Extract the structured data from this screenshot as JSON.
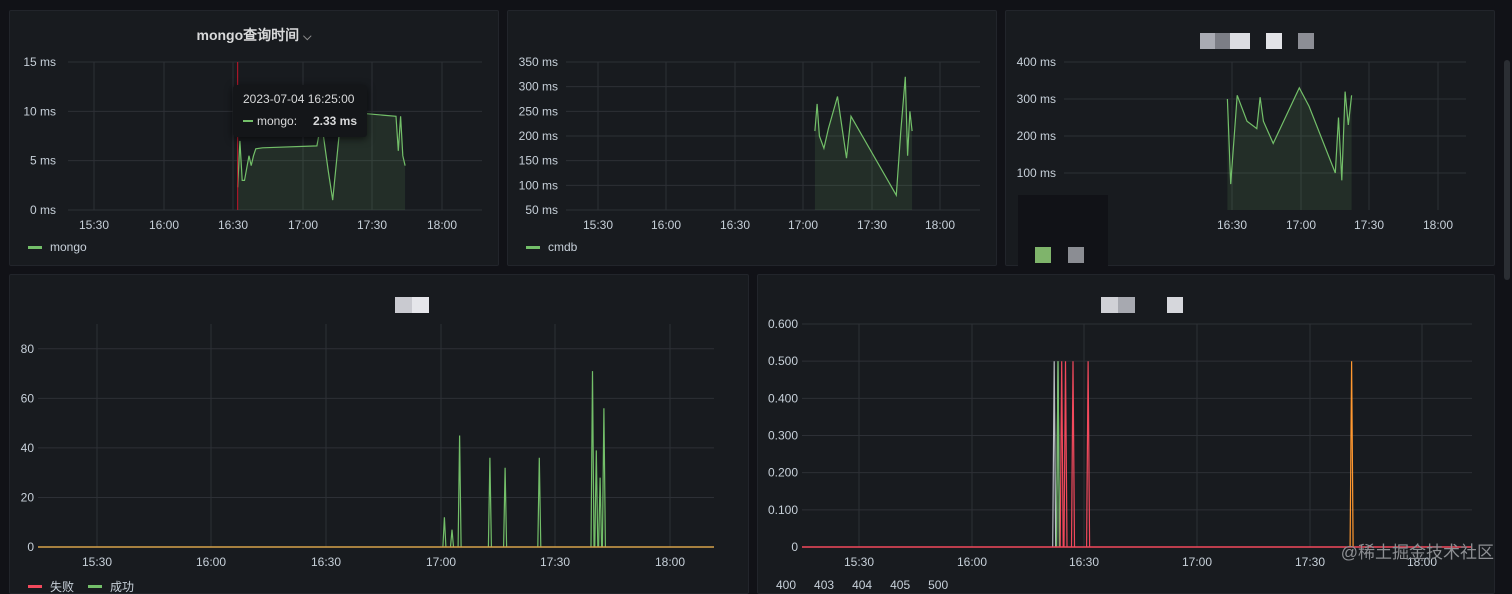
{
  "panel1": {
    "title": "mongo查询时间",
    "chevron": "⌵",
    "legend": [
      {
        "name": "mongo",
        "color": "#73bf69"
      }
    ],
    "tooltip": {
      "time": "2023-07-04 16:25:00",
      "series": "mongo:",
      "value": "2.33 ms"
    }
  },
  "panel2": {
    "legend": [
      {
        "name": "cmdb",
        "color": "#73bf69"
      }
    ]
  },
  "panel5": {
    "legend": [
      {
        "name": "失败",
        "color": "#f2495c"
      },
      {
        "name": "成功",
        "color": "#73bf69"
      }
    ]
  },
  "panel6": {
    "legend": [
      {
        "name": "400"
      },
      {
        "name": "403"
      },
      {
        "name": "404"
      },
      {
        "name": "405"
      },
      {
        "name": "500"
      }
    ]
  },
  "watermark": "@稀土掘金技术社区",
  "chart_data": [
    {
      "type": "line",
      "panel": "panel1",
      "title": "mongo查询时间",
      "x_ticks": [
        "15:30",
        "16:00",
        "16:30",
        "17:00",
        "17:30",
        "18:00"
      ],
      "y_ticks": [
        "0 ms",
        "5 ms",
        "10 ms",
        "15 ms"
      ],
      "ylim": [
        0,
        15
      ],
      "series": [
        {
          "name": "mongo",
          "color": "#73bf69",
          "x": [
            "16:25",
            "16:26",
            "16:27",
            "16:28",
            "16:30",
            "16:31",
            "16:32",
            "16:33",
            "16:36",
            "17:00",
            "17:02",
            "17:05",
            "17:07",
            "17:10",
            "17:12",
            "17:20",
            "17:35",
            "17:36",
            "17:37",
            "17:38",
            "17:39"
          ],
          "y": [
            2.3,
            7,
            3,
            3,
            5.5,
            4.5,
            5.5,
            6.2,
            6.3,
            6.5,
            9,
            4,
            1,
            8,
            10,
            9.8,
            9.5,
            6,
            9.5,
            5.5,
            4.5
          ]
        }
      ]
    },
    {
      "type": "line",
      "panel": "panel2",
      "x_ticks": [
        "15:30",
        "16:00",
        "16:30",
        "17:00",
        "17:30",
        "18:00"
      ],
      "y_ticks": [
        "50 ms",
        "100 ms",
        "150 ms",
        "200 ms",
        "250 ms",
        "300 ms",
        "350 ms"
      ],
      "ylim": [
        50,
        350
      ],
      "series": [
        {
          "name": "cmdb",
          "color": "#73bf69",
          "x": [
            "17:00",
            "17:01",
            "17:02",
            "17:04",
            "17:06",
            "17:10",
            "17:14",
            "17:16",
            "17:36",
            "17:38",
            "17:40",
            "17:41",
            "17:42",
            "17:43"
          ],
          "y": [
            210,
            265,
            200,
            175,
            215,
            280,
            155,
            240,
            80,
            210,
            320,
            160,
            250,
            210
          ]
        }
      ]
    },
    {
      "type": "line",
      "panel": "panel3",
      "x_ticks": [
        "16:30",
        "17:00",
        "17:30",
        "18:00"
      ],
      "y_ticks": [
        "100 ms",
        "200 ms",
        "300 ms",
        "400 ms"
      ],
      "ylim": [
        0,
        400
      ],
      "series": [
        {
          "color": "#73bf69",
          "x": [
            "17:00",
            "17:01",
            "17:03",
            "17:06",
            "17:09",
            "17:10",
            "17:11",
            "17:14",
            "17:22",
            "17:25",
            "17:33",
            "17:34",
            "17:35",
            "17:36",
            "17:37",
            "17:38"
          ],
          "y": [
            300,
            70,
            310,
            240,
            220,
            305,
            240,
            180,
            330,
            280,
            100,
            250,
            80,
            320,
            230,
            310
          ]
        }
      ]
    },
    {
      "type": "line",
      "panel": "panel5",
      "x_ticks": [
        "15:30",
        "16:00",
        "16:30",
        "17:00",
        "17:30",
        "18:00"
      ],
      "y_ticks": [
        "0",
        "20",
        "40",
        "60",
        "80"
      ],
      "ylim": [
        0,
        90
      ],
      "series": [
        {
          "name": "失败",
          "color": "#f2495c",
          "x": [],
          "y": []
        },
        {
          "name": "成功",
          "color": "#73bf69",
          "spikes": [
            [
              "16:59",
              12
            ],
            [
              "17:01",
              7
            ],
            [
              "17:03",
              45
            ],
            [
              "17:11",
              36
            ],
            [
              "17:15",
              32
            ],
            [
              "17:24",
              36
            ],
            [
              "17:38",
              71
            ],
            [
              "17:39",
              39
            ],
            [
              "17:40",
              28
            ],
            [
              "17:41",
              56
            ]
          ]
        }
      ]
    },
    {
      "type": "line",
      "panel": "panel6",
      "x_ticks": [
        "15:30",
        "16:00",
        "16:30",
        "17:00",
        "17:30",
        "18:00"
      ],
      "y_ticks": [
        "0",
        "0.100",
        "0.200",
        "0.300",
        "0.400",
        "0.500",
        "0.600"
      ],
      "ylim": [
        0,
        0.6
      ],
      "series": [
        {
          "color": "#b8bcc3",
          "spikes": [
            [
              "16:22",
              0.5
            ],
            [
              "16:23",
              0.5
            ]
          ]
        },
        {
          "color": "#73bf69",
          "spikes": [
            [
              "16:23",
              0.5
            ]
          ]
        },
        {
          "color": "#f2495c",
          "spikes": [
            [
              "16:24",
              0.5
            ],
            [
              "16:25",
              0.5
            ],
            [
              "16:27",
              0.5
            ],
            [
              "16:31",
              0.5
            ]
          ]
        },
        {
          "color": "#ff9830",
          "spikes": [
            [
              "17:41",
              0.5
            ]
          ]
        }
      ]
    }
  ]
}
